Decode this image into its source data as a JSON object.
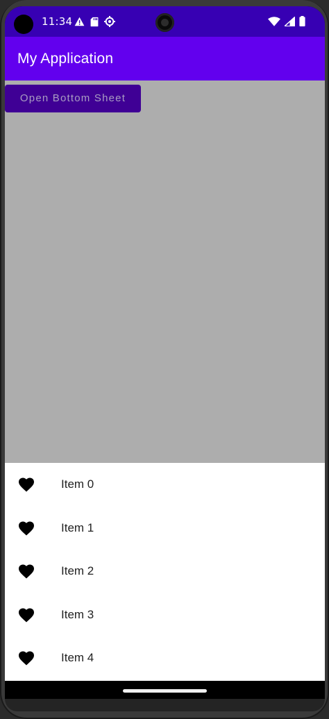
{
  "status_bar": {
    "time": "11:34",
    "left_icons": [
      "warning-icon",
      "sd-card-icon",
      "settings-icon"
    ],
    "right_icons": [
      "wifi-icon",
      "signal-icon",
      "battery-icon"
    ]
  },
  "app_bar": {
    "title": "My Application"
  },
  "content": {
    "open_sheet_button": "Open Bottom Sheet"
  },
  "bottom_sheet": {
    "items": [
      {
        "label": "Item 0",
        "icon": "heart-icon"
      },
      {
        "label": "Item 1",
        "icon": "heart-icon"
      },
      {
        "label": "Item 2",
        "icon": "heart-icon"
      },
      {
        "label": "Item 3",
        "icon": "heart-icon"
      },
      {
        "label": "Item 4",
        "icon": "heart-icon"
      }
    ]
  },
  "colors": {
    "status_bar": "#3700b3",
    "app_bar": "#6200ee",
    "scrim": "#adadad",
    "button": "#3f0095"
  }
}
